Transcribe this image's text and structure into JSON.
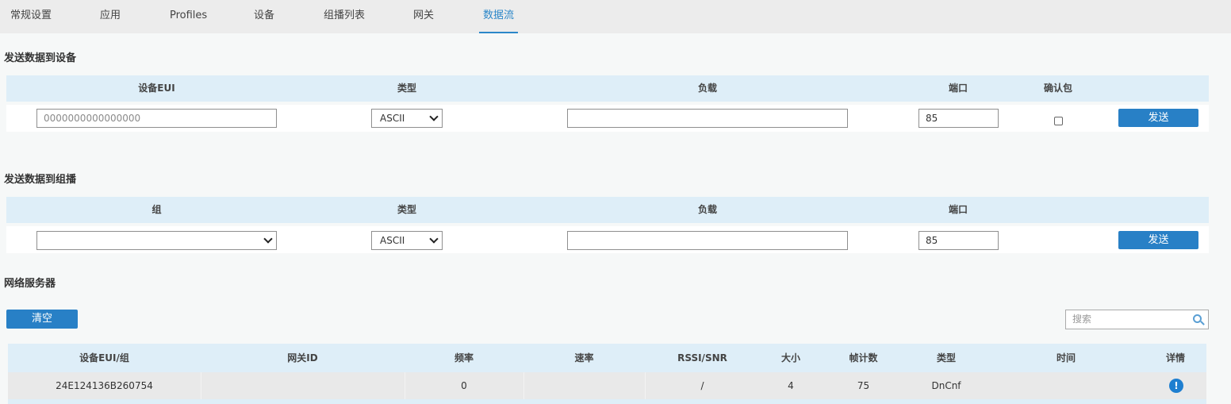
{
  "tabs": [
    "常规设置",
    "应用",
    "Profiles",
    "设备",
    "组播列表",
    "网关",
    "数据流"
  ],
  "active_tab": "数据流",
  "send_device": {
    "title": "发送数据到设备",
    "headers": {
      "eui": "设备EUI",
      "type": "类型",
      "payload": "负载",
      "port": "端口",
      "confirm": "确认包"
    },
    "eui_placeholder": "0000000000000000",
    "type_value": "ASCII",
    "payload_value": "",
    "port_value": "85",
    "confirm_checked": false,
    "send_label": "发送"
  },
  "send_group": {
    "title": "发送数据到组播",
    "headers": {
      "group": "组",
      "type": "类型",
      "payload": "负载",
      "port": "端口"
    },
    "group_value": "",
    "type_value": "ASCII",
    "payload_value": "",
    "port_value": "85",
    "send_label": "发送"
  },
  "network_server": {
    "title": "网络服务器",
    "clear_label": "清空",
    "search_placeholder": "搜索",
    "columns": [
      "设备EUI/组",
      "网关ID",
      "频率",
      "速率",
      "RSSI/SNR",
      "大小",
      "帧计数",
      "类型",
      "时间",
      "详情"
    ],
    "rows": [
      {
        "eui": "24E124136B260754",
        "gateway": "",
        "freq": "0",
        "rate": "",
        "rssi": "/",
        "size": "4",
        "fcnt": "75",
        "type": "DnCnf",
        "time": ""
      }
    ]
  },
  "colors": {
    "accent": "#2b87c9",
    "button": "#2880c6",
    "header_bg": "#deeef8"
  }
}
